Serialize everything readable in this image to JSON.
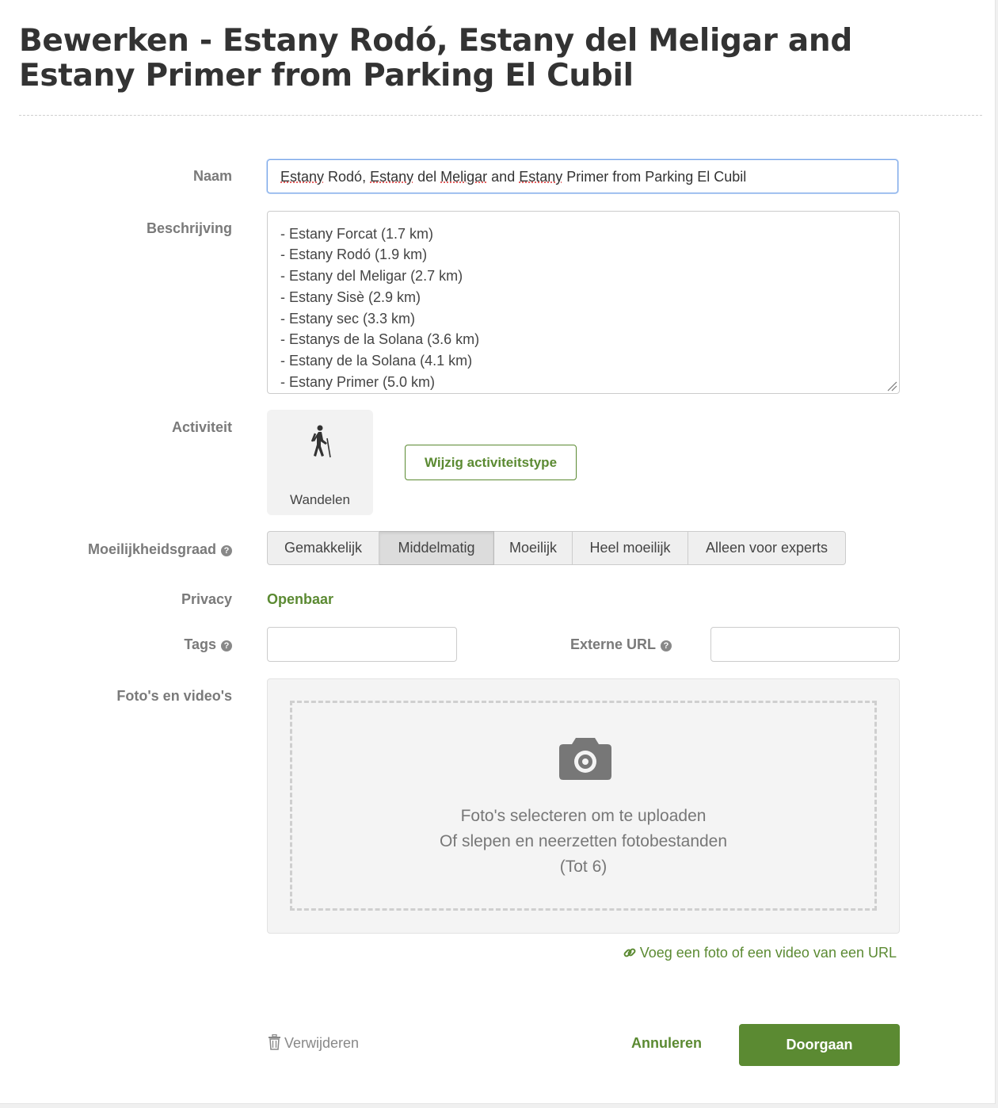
{
  "title": "Bewerken - Estany Rodó, Estany del Meligar and Estany Primer from Parking El Cubil",
  "name": {
    "label": "Naam",
    "value_parts": [
      "Estany",
      " Rodó, ",
      "Estany",
      " del ",
      "Meligar",
      " and ",
      "Estany",
      " Primer from Parking El Cubil"
    ]
  },
  "description": {
    "label": "Beschrijving",
    "lines": [
      "- Estany Forcat (1.7 km)",
      "- Estany Rodó (1.9 km)",
      "- Estany del Meligar (2.7 km)",
      "- Estany Sisè (2.9 km)",
      "- Estany sec (3.3 km)",
      "- Estanys de la Solana (3.6 km)",
      "- Estany de la Solana (4.1 km)",
      "- Estany Primer (5.0 km)"
    ]
  },
  "activity": {
    "label": "Activiteit",
    "selected": "Wandelen",
    "icon": "hiker-icon",
    "change_button": "Wijzig activiteitstype"
  },
  "difficulty": {
    "label": "Moeilijkheidsgraad",
    "options": [
      "Gemakkelijk",
      "Middelmatig",
      "Moeilijk",
      "Heel moeilijk",
      "Alleen voor experts"
    ],
    "selected": "Middelmatig"
  },
  "privacy": {
    "label": "Privacy",
    "value": "Openbaar"
  },
  "tags": {
    "label": "Tags",
    "value": ""
  },
  "external_url": {
    "label": "Externe URL",
    "value": ""
  },
  "media": {
    "label": "Foto's en video's",
    "line1": "Foto's selecteren om te uploaden",
    "line2": "Of slepen en neerzetten fotobestanden",
    "line3": "(Tot 6)",
    "url_link": "Voeg een foto of een video van een URL"
  },
  "footer": {
    "delete": "Verwijderen",
    "cancel": "Annuleren",
    "submit": "Doorgaan"
  },
  "colors": {
    "accent": "#5b8a32",
    "label": "#7a7a7a"
  }
}
